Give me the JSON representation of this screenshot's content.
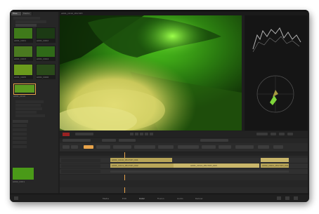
{
  "browser": {
    "tabs": [
      "Files",
      "Media"
    ],
    "thumbs": [
      {
        "label": "A001_C001",
        "color": "#3f7a1a"
      },
      {
        "label": "A001_C002",
        "color": "#1c3a14"
      },
      {
        "label": "A001_C003",
        "color": "#4a7a20"
      },
      {
        "label": "A001_C004",
        "color": "#2f6a18"
      },
      {
        "label": "A001_C005",
        "color": "#6a9a1c"
      },
      {
        "label": "A001_C006",
        "color": "#2a4a1a"
      }
    ],
    "selected_thumb": {
      "label": "A001_C010",
      "color": "#5a9a20"
    },
    "bottom_thumb": {
      "label": "A002_C001",
      "color": "#4a9a18"
    }
  },
  "viewer": {
    "title": "A001_C010_0517XH"
  },
  "timeline": {
    "clip_labels": [
      "A001_C010_0517XH_001",
      "A001_C011_0517XH_002",
      "A001_C012_0517XH_003",
      "A002_C001_0517XH_001"
    ]
  },
  "bottom_bar": {
    "tabs": [
      "Media",
      "Edit",
      "Color",
      "Fusion",
      "Audio",
      "Deliver"
    ]
  },
  "colors": {
    "accent": "#e8a34a",
    "clip": "#b8a558",
    "record": "#9a2222"
  },
  "icons": [
    "play-icon",
    "stop-icon",
    "prev-frame-icon",
    "next-frame-icon",
    "loop-icon",
    "folder-icon",
    "waveform-icon",
    "vectorscope-icon"
  ]
}
